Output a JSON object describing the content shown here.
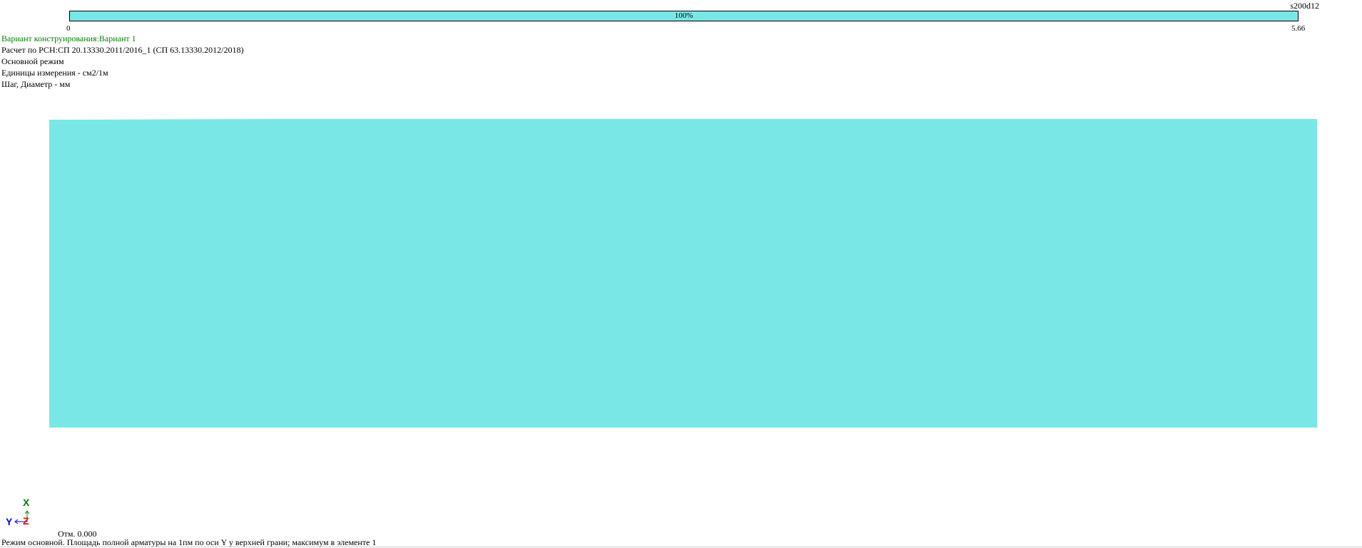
{
  "legend": {
    "label": "s200d12",
    "bar_text": "100%",
    "min": "0",
    "max": "5.66",
    "color": "#7ae7e7"
  },
  "info": {
    "variant": "Вариант конструирования:Вариант 1",
    "variant_color": "#008000",
    "norms": "Расчет по РСН:СП 20.13330.2011/2016_1 (СП 63.13330.2012/2018)",
    "mode": "Основной режим",
    "units": "Единицы измерения - см2/1м",
    "step": "Шаг, Диаметр - мм"
  },
  "plate": {
    "color": "#7ae7e7"
  },
  "axes": {
    "x_label": "X",
    "y_label": "Y",
    "z_label": "Z",
    "x_color": "#008000",
    "y_color": "#0000ff",
    "z_color": "#ff0000"
  },
  "elevation": "Отм. 0.000",
  "status": "Режим основной. Площадь полной арматуры на 1пм по оси Y у верхней грани; максимум в элементе 1"
}
